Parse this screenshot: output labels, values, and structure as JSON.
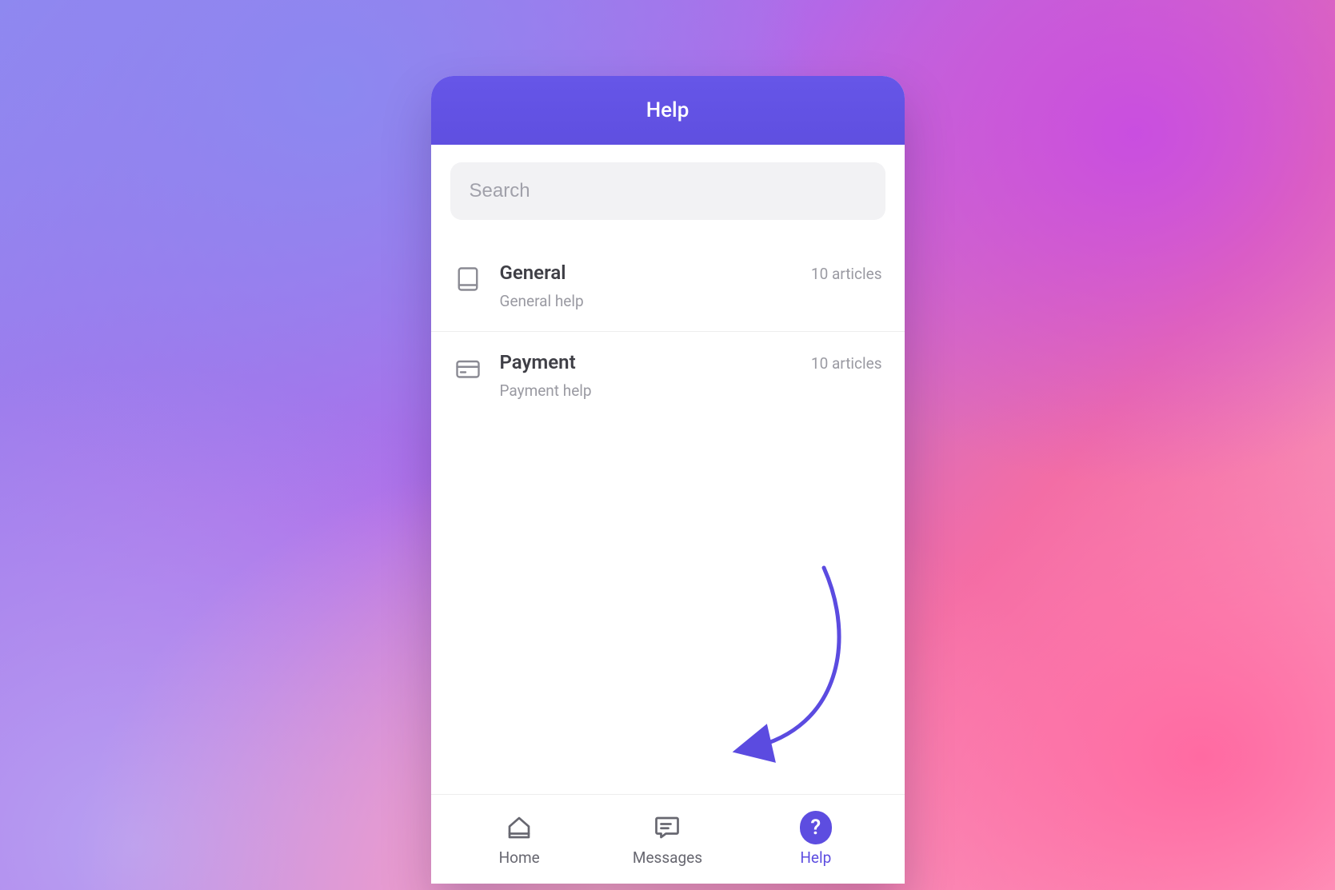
{
  "colors": {
    "accent": "#5d4de0",
    "header_bg": "#6253e3"
  },
  "header": {
    "title": "Help"
  },
  "search": {
    "placeholder": "Search",
    "value": ""
  },
  "categories": [
    {
      "icon": "book-icon",
      "title": "General",
      "subtitle": "General help",
      "count_label": "10 articles"
    },
    {
      "icon": "credit-card-icon",
      "title": "Payment",
      "subtitle": "Payment help",
      "count_label": "10 articles"
    }
  ],
  "nav": {
    "items": [
      {
        "icon": "home-icon",
        "label": "Home",
        "active": false
      },
      {
        "icon": "messages-icon",
        "label": "Messages",
        "active": false
      },
      {
        "icon": "help-icon",
        "label": "Help",
        "active": true
      }
    ]
  }
}
